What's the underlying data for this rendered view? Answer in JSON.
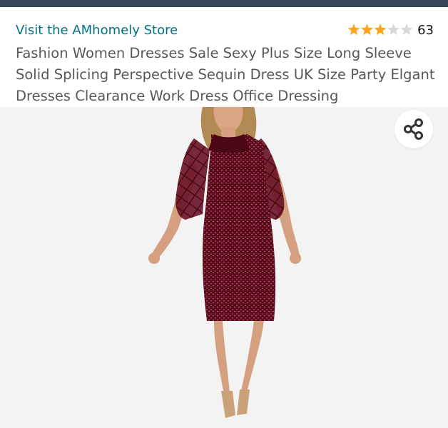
{
  "header": {
    "store_link": "Visit the AMhomely Store",
    "rating": {
      "stars": 3,
      "out_of": 5,
      "count": "63",
      "star_color": "#ffa41c",
      "empty_star_color": "#d5d9d9"
    },
    "title": "Fashion Women Dresses Sale Sexy Plus Size Long Sleeve Solid Splicing Perspective Sequin Dress UK Size Party Elgant Dresses Clearance Work Dress Office Dressing"
  },
  "colors": {
    "link": "#007185",
    "title_text": "#565959",
    "top_bar": "#37475a",
    "image_bg": "#f3f3f3",
    "dress": "#5c0d1f"
  },
  "icons": {
    "share": "share-icon"
  }
}
